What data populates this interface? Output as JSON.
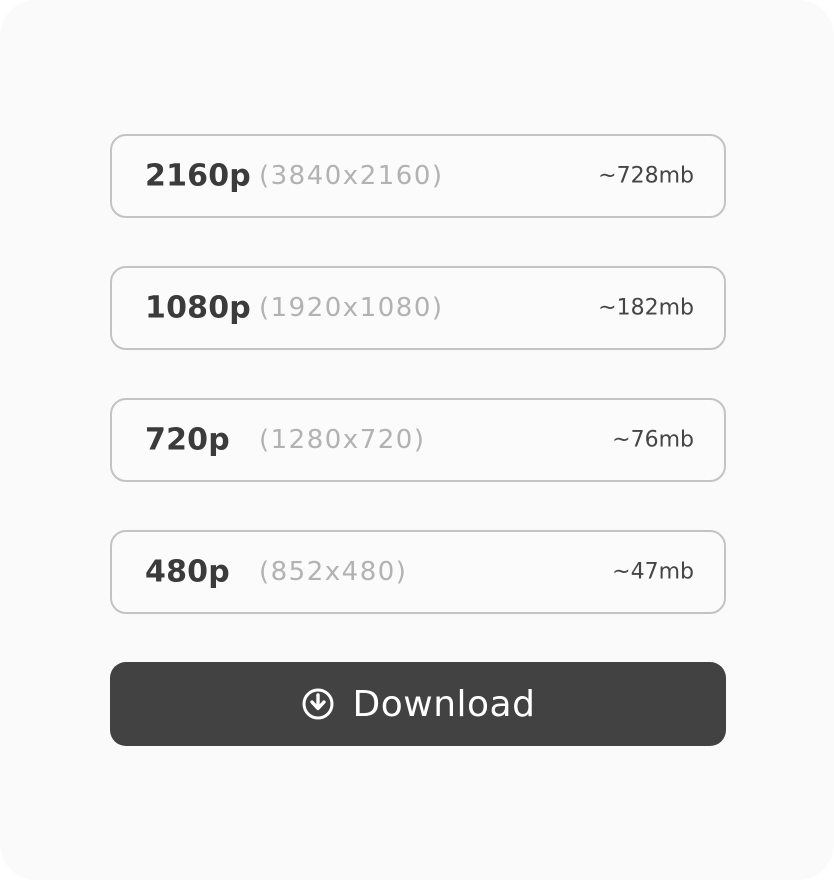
{
  "options": [
    {
      "resolution": "2160p",
      "dimensions": "(3840x2160)",
      "size": "~728mb"
    },
    {
      "resolution": "1080p",
      "dimensions": "(1920x1080)",
      "size": "~182mb"
    },
    {
      "resolution": "720p",
      "dimensions": "(1280x720)",
      "size": "~76mb"
    },
    {
      "resolution": "480p",
      "dimensions": "(852x480)",
      "size": "~47mb"
    }
  ],
  "download": {
    "label": "Download",
    "icon": "download-circle-icon"
  },
  "colors": {
    "card_background": "#fafafa",
    "option_border": "#c3c3c3",
    "resolution_text": "#3b3b3b",
    "dimensions_text": "#b2b2b2",
    "button_background": "#424242",
    "button_text": "#ffffff"
  }
}
